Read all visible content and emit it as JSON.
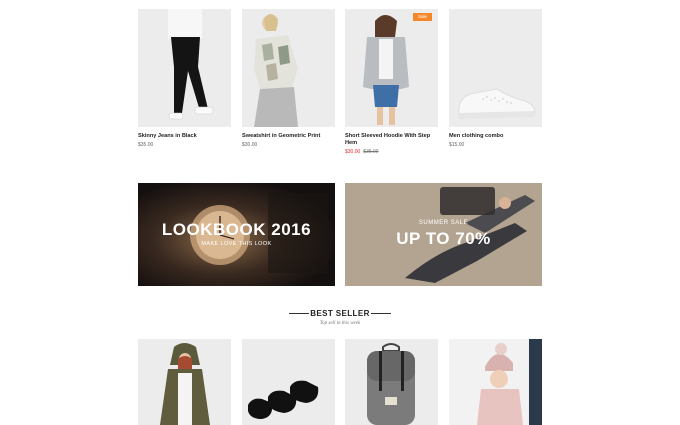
{
  "products": [
    {
      "name": "Skinny Jeans in Black",
      "price": "$35.00",
      "badge": "",
      "old_price": ""
    },
    {
      "name": "Sweatshirt in Geometric Print",
      "price": "$30.00",
      "badge": "",
      "old_price": ""
    },
    {
      "name": "Short Sleeved Hoodie With Step Hem",
      "price": "$30.00",
      "badge": "Sale",
      "old_price": "$35.00"
    },
    {
      "name": "Men clothing combo",
      "price": "$15.00",
      "badge": "",
      "old_price": ""
    }
  ],
  "banners": {
    "lookbook": {
      "title": "LOOKBOOK 2016",
      "subtitle": "MAKE LOVE THIS LOOK"
    },
    "summer": {
      "subtitle": "SUMMER SALE",
      "title": "UP TO 70%"
    }
  },
  "best_seller": {
    "title": "BEST SELLER",
    "subtitle": "Top sell in this week"
  },
  "colors": {
    "accent": "#f5872b",
    "sale_price": "#e02b2b"
  }
}
